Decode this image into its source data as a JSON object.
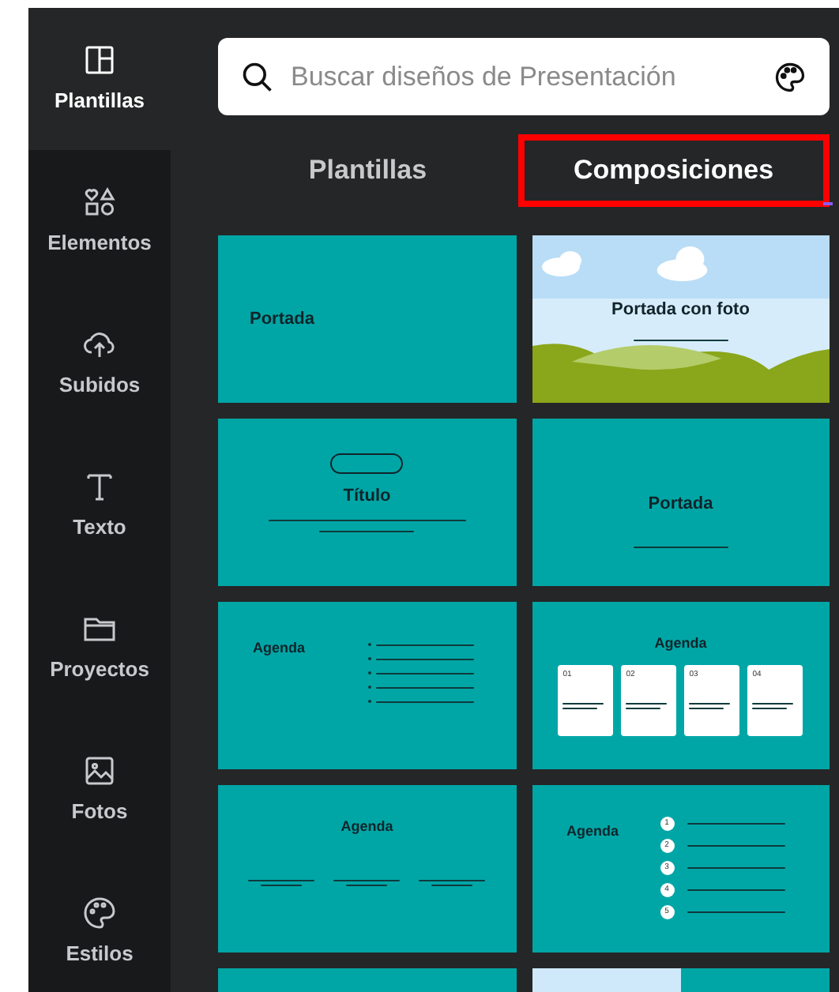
{
  "sidebar": {
    "items": [
      {
        "label": "Plantillas",
        "selected": true
      },
      {
        "label": "Elementos",
        "selected": false
      },
      {
        "label": "Subidos",
        "selected": false
      },
      {
        "label": "Texto",
        "selected": false
      },
      {
        "label": "Proyectos",
        "selected": false
      },
      {
        "label": "Fotos",
        "selected": false
      },
      {
        "label": "Estilos",
        "selected": false
      }
    ]
  },
  "search": {
    "placeholder": "Buscar diseños de Presentación"
  },
  "tabs": [
    {
      "label": "Plantillas",
      "selected": false,
      "highlighted": false
    },
    {
      "label": "Composiciones",
      "selected": true,
      "highlighted": true
    }
  ],
  "cards": [
    {
      "kind": "cover",
      "title": "Portada"
    },
    {
      "kind": "photo_cover",
      "title": "Portada con foto"
    },
    {
      "kind": "title",
      "title": "Título"
    },
    {
      "kind": "cover_sub",
      "title": "Portada"
    },
    {
      "kind": "agenda_list",
      "title": "Agenda"
    },
    {
      "kind": "agenda_cards",
      "title": "Agenda",
      "numbers": [
        "01",
        "02",
        "03",
        "04"
      ]
    },
    {
      "kind": "agenda_columns",
      "title": "Agenda"
    },
    {
      "kind": "agenda_numbered",
      "title": "Agenda",
      "numbers": [
        "1",
        "2",
        "3",
        "4",
        "5"
      ]
    },
    {
      "kind": "partial_teal"
    },
    {
      "kind": "partial_sky"
    }
  ]
}
